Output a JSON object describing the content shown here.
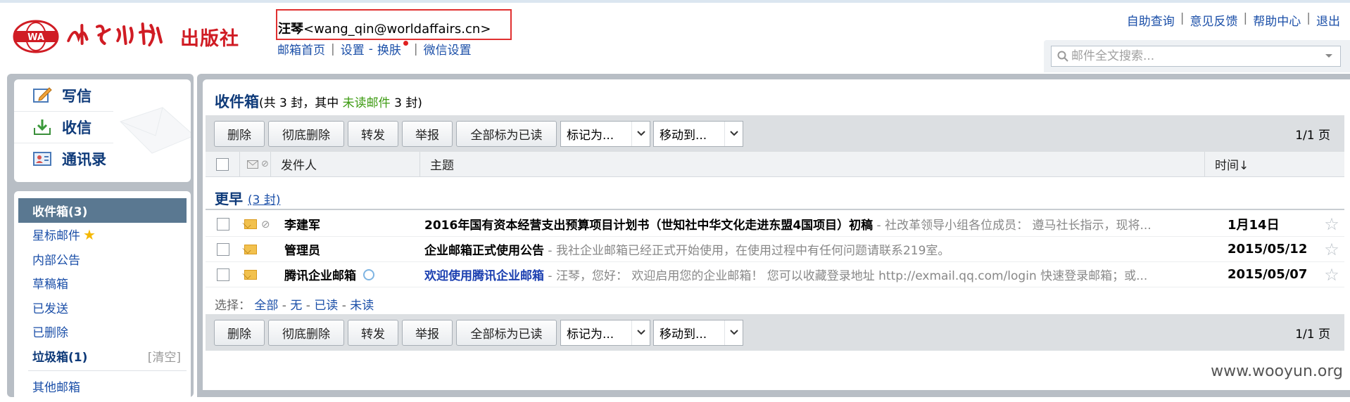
{
  "brand": {
    "publisher": "出版社",
    "calligraphy": "世界知识"
  },
  "user": {
    "name": "汪琴",
    "email": "<wang_qin@worldaffairs.cn>",
    "links": [
      "邮箱首页",
      "设置",
      "换肤",
      "微信设置"
    ]
  },
  "help_links": [
    "自助查询",
    "意见反馈",
    "帮助中心",
    "退出"
  ],
  "search": {
    "placeholder": "邮件全文搜索..."
  },
  "quick": {
    "compose": "写信",
    "receive": "收信",
    "contacts": "通讯录"
  },
  "folders": {
    "inbox": "收件箱(3)",
    "starred": "星标邮件",
    "internal": "内部公告",
    "drafts": "草稿箱",
    "sent": "已发送",
    "deleted": "已删除",
    "spam": "垃圾箱(1)",
    "spam_clear": "[清空]",
    "other": "其他邮箱"
  },
  "main": {
    "title": "收件箱",
    "summary_pre": "(共 3 封，其中 ",
    "summary_unread": "未读邮件",
    "summary_post": " 3 封)"
  },
  "toolbar": {
    "delete": "删除",
    "purge": "彻底删除",
    "forward": "转发",
    "report": "举报",
    "mark_all_read": "全部标为已读",
    "mark_as": "标记为...",
    "move_to": "移动到...",
    "pager": "1/1 页"
  },
  "columns": {
    "sender": "发件人",
    "subject": "主题",
    "time": "时间↓"
  },
  "group": {
    "label": "更早",
    "count": "(3 封)"
  },
  "rows": [
    {
      "sender": "李建军",
      "subject": "2016年国有资本经营支出预算项目计划书（世知社中华文化走进东盟4国项目）初稿",
      "preview": " - 社改革领导小组各位成员： 遵马社长指示，现将...",
      "date": "1月14日"
    },
    {
      "sender": "管理员",
      "subject": "企业邮箱正式使用公告",
      "preview": " - 我社企业邮箱已经正式开始使用，在使用过程中有任何问题请联系219室。",
      "date": "2015/05/12"
    },
    {
      "sender": "腾讯企业邮箱",
      "subject": "欢迎使用腾讯企业邮箱",
      "preview": " - 汪琴，您好： 欢迎启用您的企业邮箱！ 您可以收藏登录地址 http://exmail.qq.com/login 快速登录邮箱；或...",
      "date": "2015/05/07"
    }
  ],
  "select_line": {
    "label": "选择：",
    "all": "全部",
    "none": "无",
    "read": "已读",
    "unread": "未读"
  },
  "watermark": "www.wooyun.org",
  "colors": {
    "accent": "#0e3a79",
    "link": "#1b4fa8",
    "brand_red": "#d01c24",
    "unread_green": "#3d9b12"
  }
}
